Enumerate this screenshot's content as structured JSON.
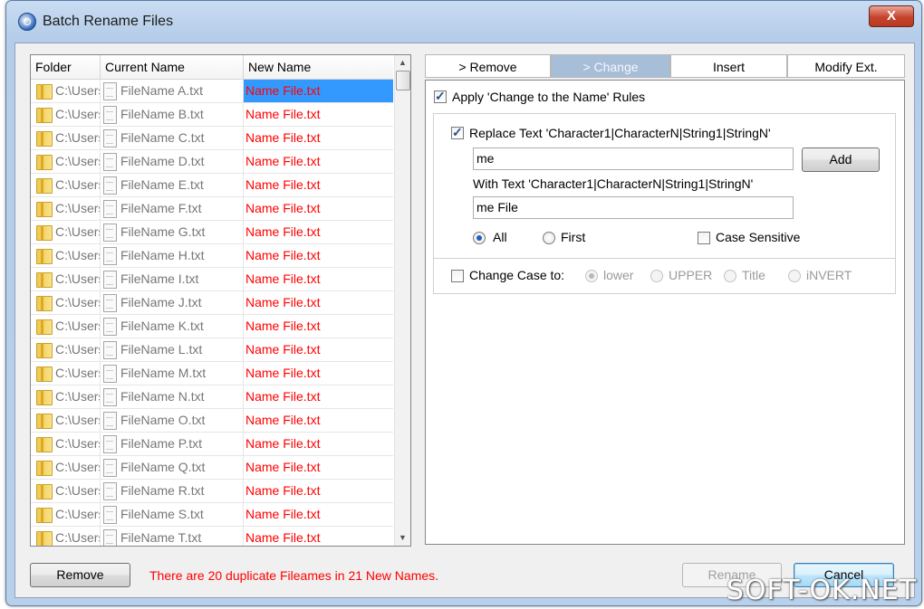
{
  "window": {
    "title": "Batch Rename Files",
    "close_glyph": "X"
  },
  "list": {
    "columns": [
      "Folder",
      "Current Name",
      "New Name"
    ],
    "rows": [
      {
        "folder": "C:\\Users",
        "current": "FileName A.txt",
        "new": "Name File.txt"
      },
      {
        "folder": "C:\\Users",
        "current": "FileName B.txt",
        "new": "Name File.txt"
      },
      {
        "folder": "C:\\Users",
        "current": "FileName C.txt",
        "new": "Name File.txt"
      },
      {
        "folder": "C:\\Users",
        "current": "FileName D.txt",
        "new": "Name File.txt"
      },
      {
        "folder": "C:\\Users",
        "current": "FileName E.txt",
        "new": "Name File.txt"
      },
      {
        "folder": "C:\\Users",
        "current": "FileName F.txt",
        "new": "Name File.txt"
      },
      {
        "folder": "C:\\Users",
        "current": "FileName G.txt",
        "new": "Name File.txt"
      },
      {
        "folder": "C:\\Users",
        "current": "FileName H.txt",
        "new": "Name File.txt"
      },
      {
        "folder": "C:\\Users",
        "current": "FileName I.txt",
        "new": "Name File.txt"
      },
      {
        "folder": "C:\\Users",
        "current": "FileName J.txt",
        "new": "Name File.txt"
      },
      {
        "folder": "C:\\Users",
        "current": "FileName K.txt",
        "new": "Name File.txt"
      },
      {
        "folder": "C:\\Users",
        "current": "FileName L.txt",
        "new": "Name File.txt"
      },
      {
        "folder": "C:\\Users",
        "current": "FileName M.txt",
        "new": "Name File.txt"
      },
      {
        "folder": "C:\\Users",
        "current": "FileName N.txt",
        "new": "Name File.txt"
      },
      {
        "folder": "C:\\Users",
        "current": "FileName O.txt",
        "new": "Name File.txt"
      },
      {
        "folder": "C:\\Users",
        "current": "FileName P.txt",
        "new": "Name File.txt"
      },
      {
        "folder": "C:\\Users",
        "current": "FileName Q.txt",
        "new": "Name File.txt"
      },
      {
        "folder": "C:\\Users",
        "current": "FileName R.txt",
        "new": "Name File.txt"
      },
      {
        "folder": "C:\\Users",
        "current": "FileName S.txt",
        "new": "Name File.txt"
      },
      {
        "folder": "C:\\Users",
        "current": "FileName T.txt",
        "new": "Name File.txt"
      }
    ],
    "selected_row": 0
  },
  "tabs": [
    {
      "label": "> Remove",
      "active": false
    },
    {
      "label": "> Change",
      "active": true
    },
    {
      "label": "Insert",
      "active": false
    },
    {
      "label": "Modify Ext.",
      "active": false
    }
  ],
  "change": {
    "apply_label": "Apply 'Change to the Name' Rules",
    "apply_checked": true,
    "replace_label": "Replace Text  'Character1|CharacterN|String1|StringN'",
    "replace_checked": true,
    "replace_value": "me",
    "add_label": "Add",
    "with_label": "With Text  'Character1|CharacterN|String1|StringN'",
    "with_value": "me File",
    "scope_all_label": "All",
    "scope_first_label": "First",
    "scope_selected": "All",
    "case_sensitive_label": "Case Sensitive",
    "case_sensitive_checked": false,
    "change_case_label": "Change Case to:",
    "change_case_checked": false,
    "case_options": [
      "lower",
      "UPPER",
      "Title",
      "iNVERT"
    ],
    "case_selected": "lower"
  },
  "bottom": {
    "remove_label": "Remove",
    "status": "There are 20 duplicate Fileames in 21 New Names.",
    "rename_label": "Rename",
    "cancel_label": "Cancel"
  },
  "watermark": "SOFT-OK.NET",
  "colors": {
    "new_name_text": "#ff0000",
    "selection": "#3399ff",
    "active_tab": "#a7bed8"
  }
}
